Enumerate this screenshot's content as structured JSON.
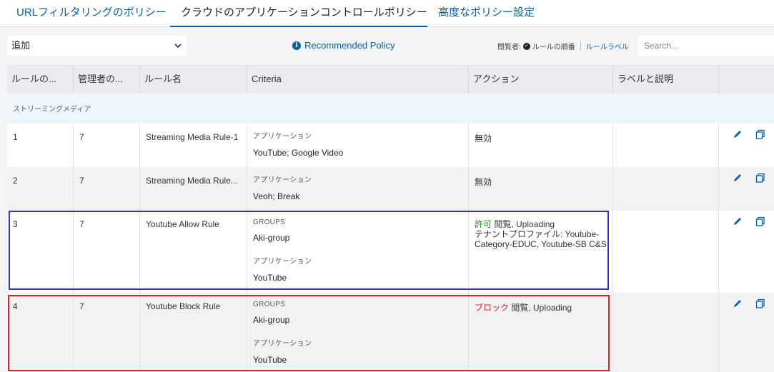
{
  "tabs": [
    {
      "label": "URLフィルタリングのポリシー"
    },
    {
      "label": "クラウドのアプリケーションコントロールポリシー"
    },
    {
      "label": "高度なポリシー設定"
    }
  ],
  "toolbar": {
    "add_select": "追加",
    "recommended": "Recommended Policy",
    "view_by_label": "閲覧者:",
    "view_rule_order": "ルールの順番",
    "view_rule_label": "ルールラベル",
    "search_placeholder": "Search..."
  },
  "columns": [
    "ルールの...",
    "管理者の...",
    "ルール名",
    "Criteria",
    "アクション",
    "ラベルと説明"
  ],
  "group": {
    "label": "ストリーミングメディア"
  },
  "rows": [
    {
      "order": "1",
      "admin": "7",
      "name": "Streaming Media Rule-1",
      "c1_label": "アプリケーション",
      "c1_value": "YouTube; Google Video",
      "action": "無効"
    },
    {
      "order": "2",
      "admin": "7",
      "name": "Streaming Media Rule...",
      "c1_label": "アプリケーション",
      "c1_value": "Veoh; Break",
      "action": "無効"
    },
    {
      "order": "3",
      "admin": "7",
      "name": "Youtube Allow Rule",
      "c1_label": "GROUPS",
      "c1_value": "Aki-group",
      "c2_label": "アプリケーション",
      "c2_value": "YouTube",
      "action_kw": "許可",
      "action_rest": " 閲覧, Uploading",
      "action_line2": "テナントプロファイル: Youtube-Category-EDUC, Youtube-SB C&S"
    },
    {
      "order": "4",
      "admin": "7",
      "name": "Youtube Block Rule",
      "c1_label": "GROUPS",
      "c1_value": "Aki-group",
      "c2_label": "アプリケーション",
      "c2_value": "YouTube",
      "action_kw": "ブロック",
      "action_rest": " 閲覧, Uploading"
    }
  ],
  "colors": {
    "accent": "#0b5f9c",
    "allow": "#2a8a2a",
    "block": "#dd2222",
    "outline_blue": "#3333bb"
  },
  "icons": [
    "chevron-down-icon",
    "info-icon",
    "check-icon",
    "edit-icon",
    "copy-icon"
  ]
}
